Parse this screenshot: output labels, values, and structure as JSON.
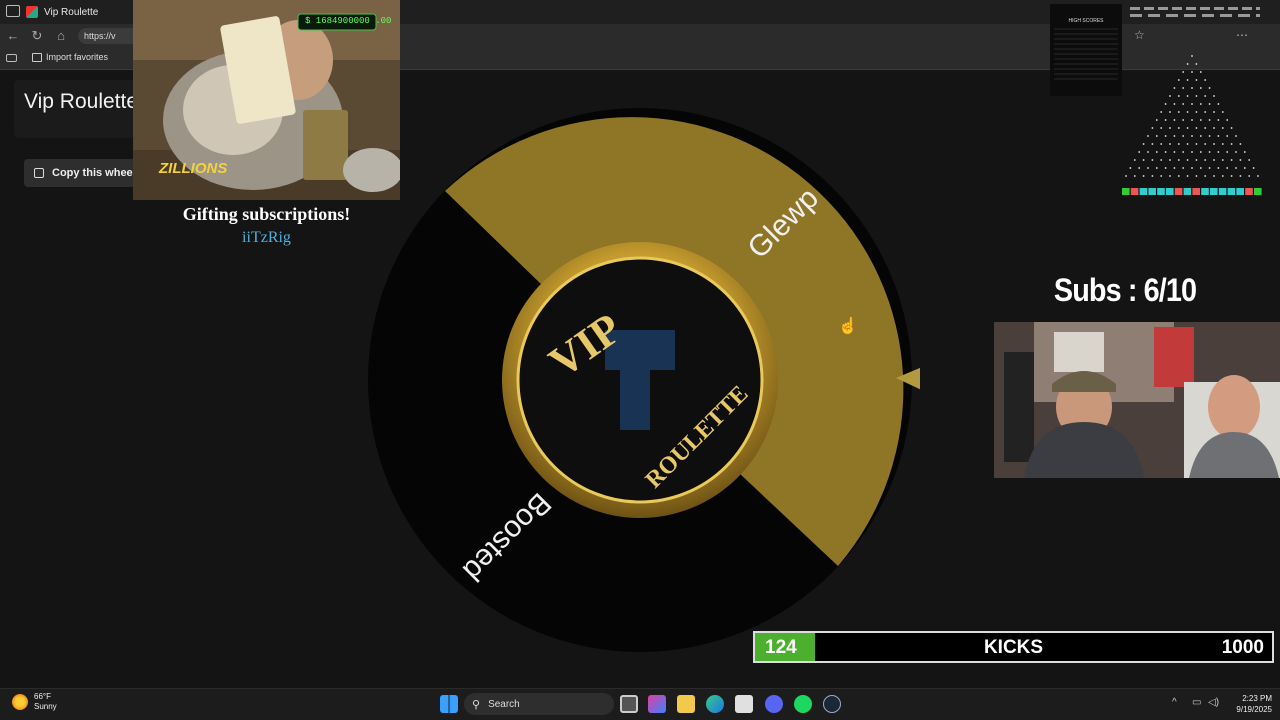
{
  "browser": {
    "tab_title": "Vip Roulette",
    "url": "https://v",
    "favorites_label": "Import favorites"
  },
  "page": {
    "title": "Vip Roulette",
    "copy_button_label": "Copy this wheel"
  },
  "gift_alert": {
    "counter": "$ 1684900000 .00",
    "badge_text": "ZILLIONS",
    "message": "Gifting subscriptions!",
    "username": "iiTzRig"
  },
  "wheel": {
    "segments": [
      {
        "label": "Glewp",
        "color": "#8f7526"
      },
      {
        "label": "Boosted",
        "color": "#050505"
      }
    ],
    "center_text_top": "VIP",
    "center_text_bottom": "ROULETTE",
    "pointer_color": "#b49a3e"
  },
  "subs_counter": {
    "text": "Subs : 6/10",
    "current": 6,
    "goal": 10
  },
  "kicks_bar": {
    "current_value": "124",
    "label": "KICKS",
    "goal_value": "1000",
    "progress_fraction": 0.124,
    "fill_color": "#4caf2e"
  },
  "scoreboard": {
    "title": "HIGH SCORES"
  },
  "taskbar": {
    "temperature": "66°F",
    "condition": "Sunny",
    "search_label": "Search",
    "time": "2:23 PM",
    "date": "9/19/2025"
  }
}
